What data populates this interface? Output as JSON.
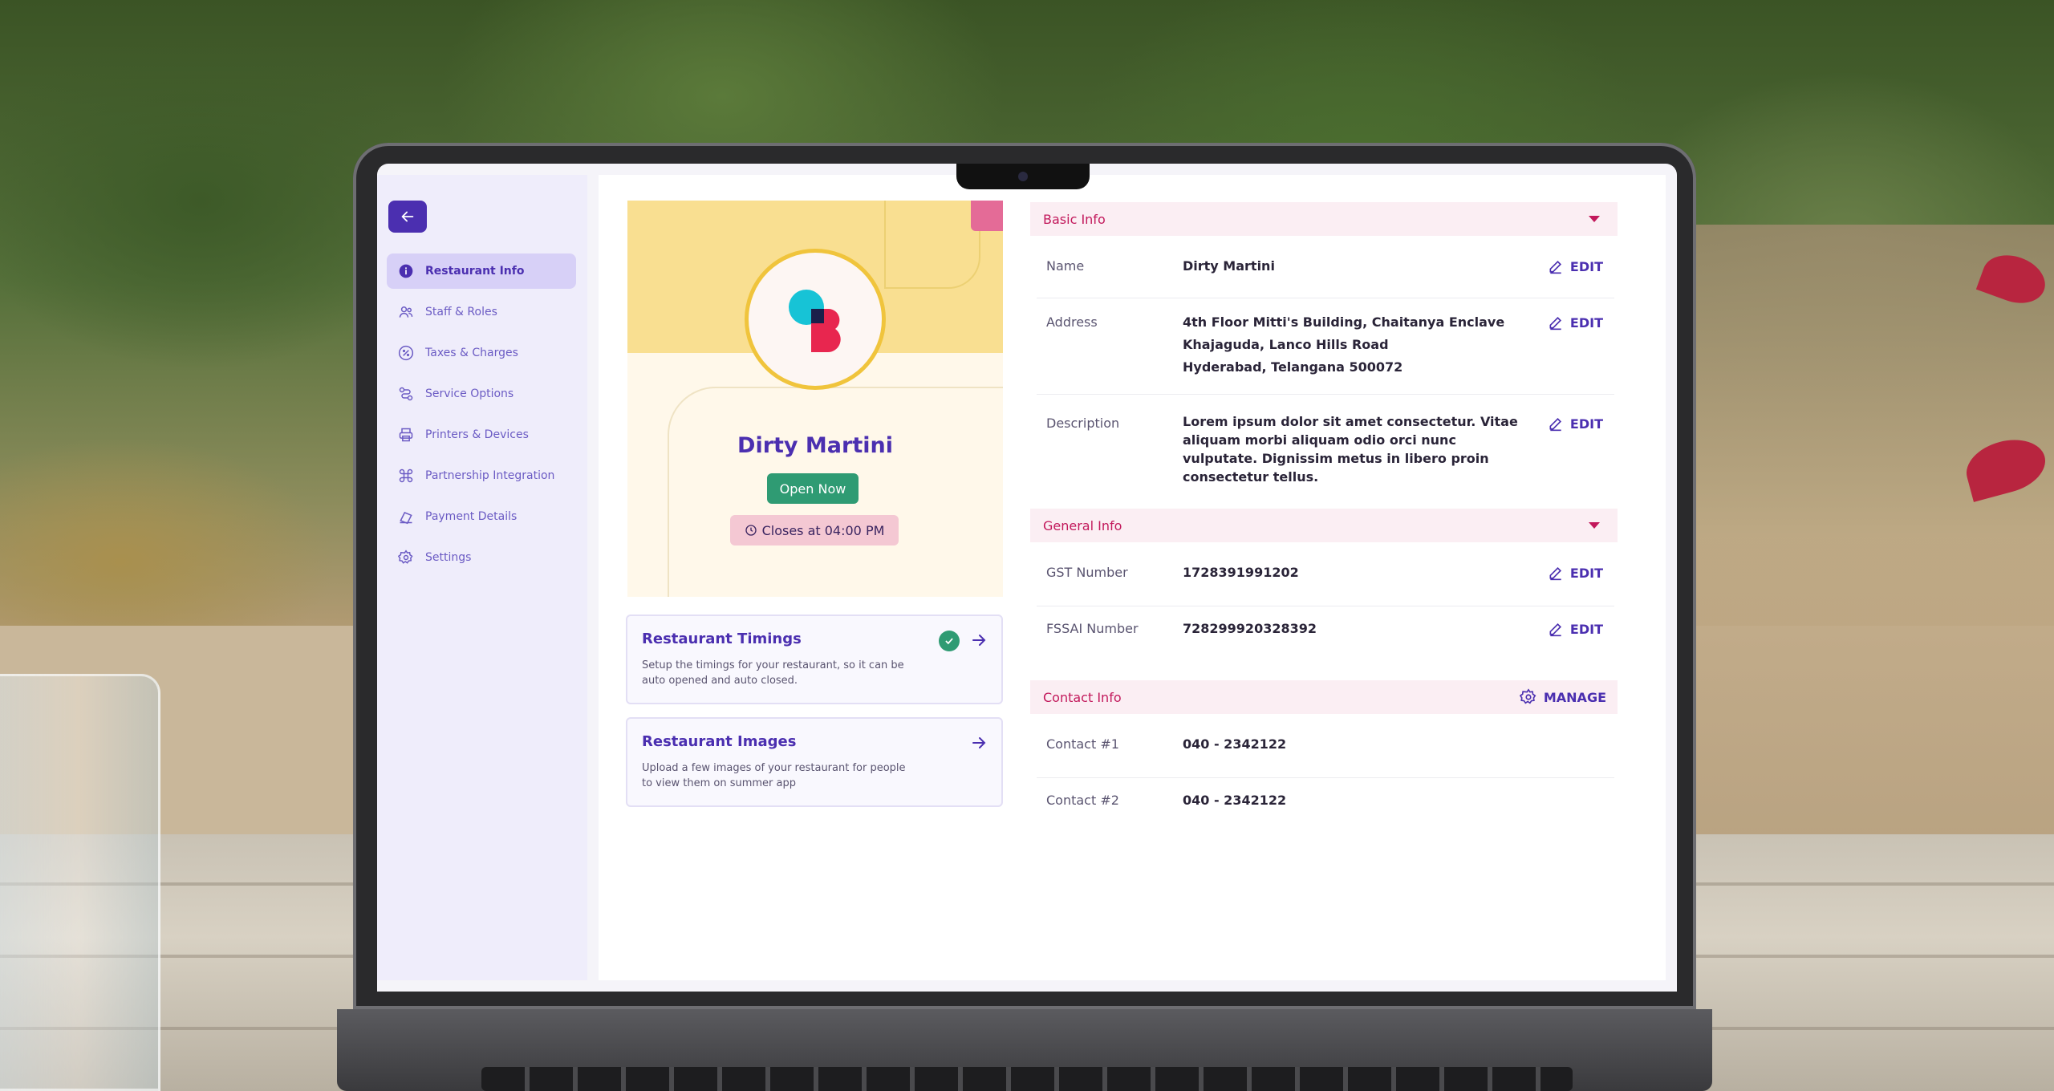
{
  "sidebar": {
    "items": [
      {
        "label": "Restaurant Info",
        "icon": "info-icon",
        "active": true
      },
      {
        "label": "Staff & Roles",
        "icon": "users-icon"
      },
      {
        "label": "Taxes & Charges",
        "icon": "percent-icon"
      },
      {
        "label": "Service Options",
        "icon": "service-icon"
      },
      {
        "label": "Printers & Devices",
        "icon": "printer-icon"
      },
      {
        "label": "Partnership Integration",
        "icon": "command-icon"
      },
      {
        "label": "Payment Details",
        "icon": "payment-icon"
      },
      {
        "label": "Settings",
        "icon": "gear-icon"
      }
    ]
  },
  "hero": {
    "name": "Dirty Martini",
    "status": "Open Now",
    "closes": "Closes at 04:00 PM"
  },
  "cards": {
    "timings": {
      "title": "Restaurant Timings",
      "desc": "Setup the timings for your restaurant, so it can be auto opened and auto closed."
    },
    "images": {
      "title": "Restaurant Images",
      "desc": "Upload a few images of your restaurant for people to view them on summer app"
    }
  },
  "basic_info": {
    "title": "Basic Info",
    "name_label": "Name",
    "name_value": "Dirty Martini",
    "address_label": "Address",
    "address_line1": "4th Floor Mitti's Building, Chaitanya Enclave",
    "address_line2": "Khajaguda, Lanco Hills Road",
    "address_line3": "Hyderabad, Telangana 500072",
    "description_label": "Description",
    "description_value": "Lorem ipsum dolor sit amet consectetur. Vitae aliquam morbi aliquam odio orci nunc vulputate. Dignissim metus in libero proin consectetur tellus."
  },
  "general_info": {
    "title": "General Info",
    "gst_label": "GST Number",
    "gst_value": "1728391991202",
    "fssai_label": "FSSAI Number",
    "fssai_value": "728299920328392"
  },
  "contact_info": {
    "title": "Contact Info",
    "manage_label": "MANAGE",
    "contact1_label": "Contact #1",
    "contact1_value": "040 - 2342122",
    "contact2_label": "Contact #2",
    "contact2_value": "040 - 2342122"
  },
  "edit_label": "EDIT",
  "colors": {
    "primary": "#4b2fb0",
    "accent": "#c2185b",
    "success": "#2f9b73",
    "sidebar_bg": "#efedfb"
  }
}
